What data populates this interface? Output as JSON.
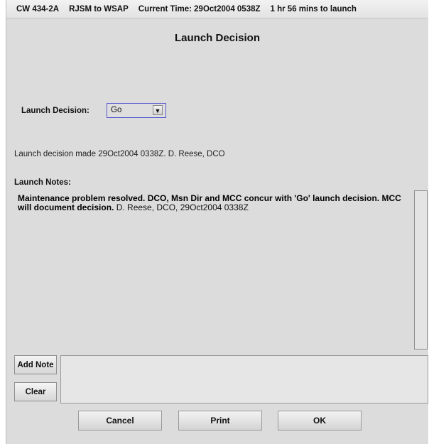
{
  "titlebar": {
    "mission": "CW 434-2A",
    "route": "RJSM to WSAP",
    "current_time": "Current Time: 29Oct2004 0538Z",
    "countdown": "1 hr 56 mins to launch"
  },
  "dialog": {
    "title": "Launch Decision"
  },
  "launch_decision": {
    "label": "Launch Decision:",
    "selected": "Go",
    "dropdown_icon": "triangle-down-icon"
  },
  "decision_made_text": "Launch decision made 29Oct2004 0338Z. D. Reese, DCO",
  "launch_notes": {
    "label": "Launch Notes:",
    "note_bold": "Maintenance problem resolved.  DCO, Msn Dir and MCC concur with 'Go' launch decision.  MCC will document decision.",
    "note_author": " D. Reese, DCO, 29Oct2004 0338Z"
  },
  "note_input": {
    "value": "",
    "add_note_label": "Add Note",
    "clear_label": "Clear"
  },
  "buttons": {
    "cancel": "Cancel",
    "print": "Print",
    "ok": "OK"
  },
  "colors": {
    "background": "#dcdcdc",
    "dropdown_border": "#5a5ad0"
  }
}
